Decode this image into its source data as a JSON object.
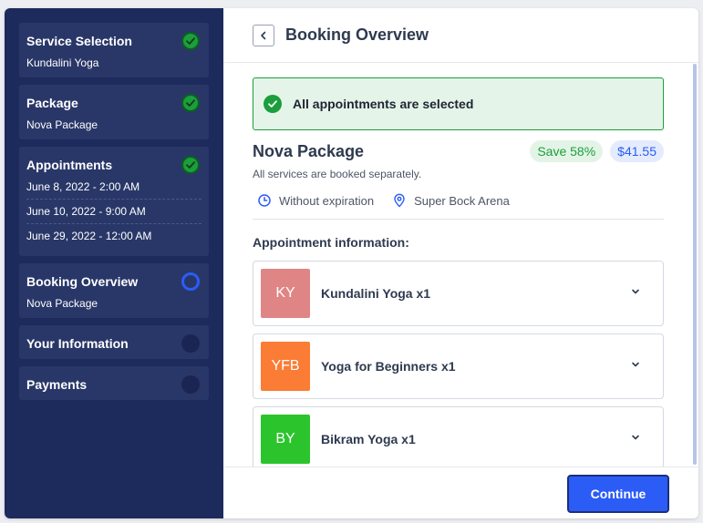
{
  "sidebar": {
    "steps": [
      {
        "title": "Service Selection",
        "sub": "Kundalini Yoga",
        "status": "done"
      },
      {
        "title": "Package",
        "sub": "Nova Package",
        "status": "done"
      },
      {
        "title": "Appointments",
        "status": "done",
        "items": [
          "June 8, 2022 - 2:00 AM",
          "June 10, 2022 - 9:00 AM",
          "June 29, 2022 - 12:00 AM"
        ]
      },
      {
        "title": "Booking Overview",
        "sub": "Nova Package",
        "status": "current"
      },
      {
        "title": "Your Information",
        "status": "todo"
      },
      {
        "title": "Payments",
        "status": "todo"
      }
    ]
  },
  "header": {
    "title": "Booking Overview",
    "back_icon": "chevron-left-icon"
  },
  "alert": {
    "text": "All appointments are selected",
    "icon": "check-circle-icon"
  },
  "package": {
    "name": "Nova Package",
    "save_badge": "Save 58%",
    "price_badge": "$41.55",
    "description": "All services are booked separately.",
    "expiration": "Without expiration",
    "location": "Super Bock Arena"
  },
  "appointments": {
    "label": "Appointment information:",
    "items": [
      {
        "initials": "KY",
        "name": "Kundalini Yoga x1",
        "color": "#e08585"
      },
      {
        "initials": "YFB",
        "name": "Yoga for Beginners x1",
        "color": "#fb7c34"
      },
      {
        "initials": "BY",
        "name": "Bikram Yoga x1",
        "color": "#2cc42c"
      }
    ]
  },
  "footer": {
    "continue_label": "Continue"
  },
  "colors": {
    "sidebar_bg": "#1d2a5c",
    "accent": "#2b5cf6",
    "success": "#1b9e3b"
  }
}
